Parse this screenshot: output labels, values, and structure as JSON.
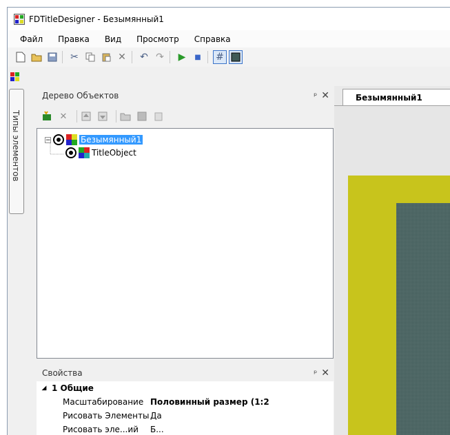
{
  "window": {
    "title": "FDTitleDesigner - Безымянный1"
  },
  "menu": [
    {
      "label": "Файл"
    },
    {
      "label": "Правка"
    },
    {
      "label": "Вид"
    },
    {
      "label": "Просмотр"
    },
    {
      "label": "Справка"
    }
  ],
  "toolbar": {
    "icons": [
      "new-file-icon",
      "open-folder-icon",
      "save-icon",
      "cut-icon",
      "copy-icon",
      "paste-icon",
      "delete-icon",
      "undo-icon",
      "redo-icon",
      "play-icon",
      "stop-icon",
      "grid-toggle-icon",
      "background-toggle-icon"
    ]
  },
  "side_tab": {
    "label": "Типы элементов"
  },
  "tree_panel": {
    "title": "Дерево Объектов",
    "pin_glyph": "ᵖ",
    "close_glyph": "✕",
    "toolbar_icons": [
      "add-object-icon",
      "delete-object-icon",
      "move-up-icon",
      "move-down-icon",
      "open-icon",
      "save-object-icon",
      "clipboard-icon"
    ],
    "items": [
      {
        "label": "Безымянный1",
        "selected": true,
        "expanded": true
      },
      {
        "label": "TitleObject",
        "selected": false
      }
    ]
  },
  "properties_panel": {
    "title": "Свойства",
    "category": "1 Общие",
    "rows": [
      {
        "name": "Масштабирование",
        "value": "Половинный размер (1:2"
      },
      {
        "name": "Рисовать Элементы",
        "value": "Да"
      },
      {
        "name": "Рисовать эле...ий",
        "value": "Б..."
      }
    ]
  },
  "document_tab": {
    "label": "Безымянный1"
  },
  "colors": {
    "canvas_outer": "#c8c41c",
    "canvas_inner": "#3f5a58",
    "selection": "#3399ff"
  }
}
